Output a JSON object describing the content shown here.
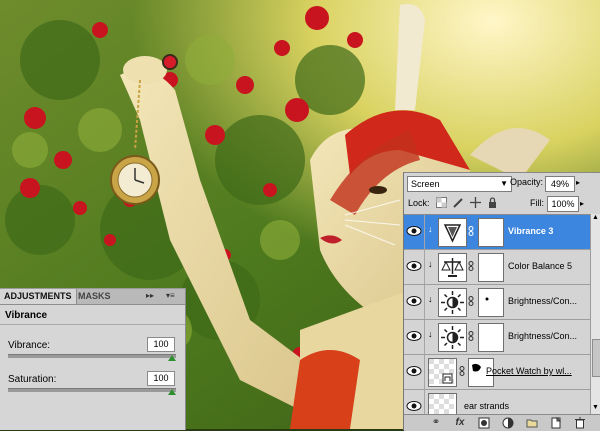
{
  "adjustments_panel": {
    "tabs": [
      "ADJUSTMENTS",
      "MASKS"
    ],
    "collapse_glyph": "▸▸",
    "menu_glyph": "▾≡",
    "title": "Vibrance",
    "vibrance": {
      "label": "Vibrance:",
      "value": "100",
      "level": 1.0
    },
    "saturation": {
      "label": "Saturation:",
      "value": "100",
      "level": 1.0
    }
  },
  "layers_panel": {
    "blend_mode": "Screen",
    "opacity_label": "Opacity:",
    "opacity_value": "49%",
    "lock_label": "Lock:",
    "fill_label": "Fill:",
    "fill_value": "100%",
    "layers": [
      {
        "name": "Vibrance 3",
        "type": "vibrance",
        "selected": true,
        "clipped": true
      },
      {
        "name": "Color Balance 5",
        "type": "color-balance",
        "selected": false,
        "clipped": true
      },
      {
        "name": "Brightness/Con...",
        "type": "brightness",
        "selected": false,
        "clipped": true
      },
      {
        "name": "Brightness/Con...",
        "type": "brightness",
        "selected": false,
        "clipped": true
      },
      {
        "name": "Pocket Watch by wl...",
        "type": "smart-object",
        "selected": false,
        "clipped": false
      },
      {
        "name": "ear strands",
        "type": "pixel",
        "selected": false,
        "clipped": false
      }
    ],
    "footer_icons": [
      "link-icon",
      "fx-icon",
      "mask-icon",
      "adjustment-icon",
      "folder-icon",
      "new-layer-icon",
      "trash-icon"
    ]
  },
  "colors": {
    "selection": "#3d86e0",
    "panel": "#d4d4d4",
    "slider_thumb": "#2e8f2e"
  }
}
